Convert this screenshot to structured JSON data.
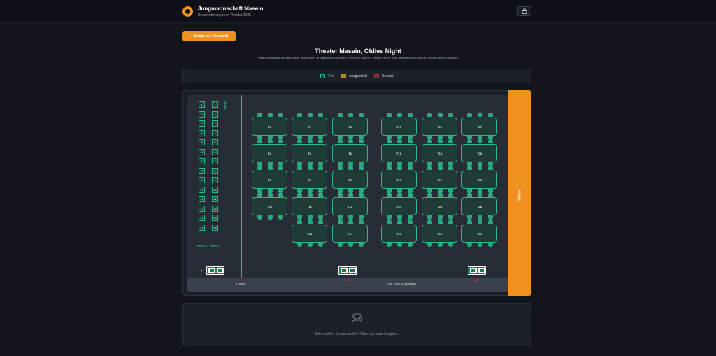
{
  "header": {
    "org_name": "Jungmannschaft Masein",
    "org_sub": "Reservationssystem Theater 2025",
    "user_icon": "lock-icon"
  },
  "back_button": {
    "label": "Zurück zur Übersicht",
    "icon": "arrow-left-icon"
  },
  "page": {
    "title": "Theater Masein, Oldies Night",
    "subtitle": "Stühle können einzeln oder mehrfach ausgewählt werden. Klicken Sie auf einen Tisch, um automatisch alle 6 Stühle auszuwählen"
  },
  "legend": [
    {
      "label": "Frei",
      "color": "#1e3b36",
      "border": "#2fb98a"
    },
    {
      "label": "Ausgewählt",
      "color": "#a87a2a",
      "border": "#d39a36"
    },
    {
      "label": "Besetzt",
      "color": "#6b2a2a",
      "border": "#b23a3a"
    }
  ],
  "stage_label": "Bühne",
  "room": {
    "buehne_side_label": "Bühne",
    "row1": {
      "label": "Reihe 1",
      "seats": [
        "1",
        "2",
        "3",
        "4",
        "5",
        "6",
        "7",
        "8",
        "9",
        "10",
        "11",
        "12",
        "13",
        "14"
      ]
    },
    "row2": {
      "label": "Reihe 2",
      "seats": [
        "1",
        "2",
        "3",
        "4",
        "5",
        "6",
        "7",
        "8",
        "9",
        "10",
        "11",
        "12",
        "13",
        "14"
      ]
    },
    "tables": [
      "T1",
      "T2",
      "T3",
      "T4",
      "T5",
      "T6",
      "T7",
      "T8",
      "T9",
      "T10",
      "T11",
      "T12",
      "T13",
      "T14",
      "T15",
      "T16",
      "T17",
      "T18",
      "T19",
      "T20",
      "T21",
      "T22",
      "T23",
      "T24",
      "T25",
      "T26",
      "T27",
      "T28",
      "T29"
    ]
  },
  "footer": {
    "kitchen": "Küche",
    "entrance": "Ein- und Ausgänge"
  },
  "selection": {
    "icon": "sofa-icon",
    "message": "Bitte wählen Sie zuerst Ihre Plätze aus dem Saalplan."
  },
  "colors": {
    "accent": "#f0901e",
    "free": "#1e3b36",
    "free_border": "#2fb98a",
    "background": "#12151b"
  }
}
